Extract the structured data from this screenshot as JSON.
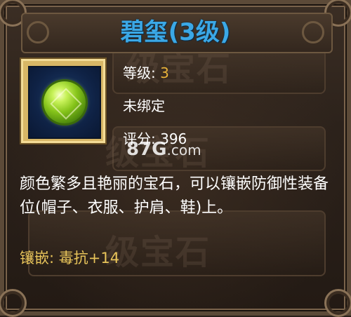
{
  "item": {
    "name": "碧玺(3级)",
    "name_color": "#3ba8e6",
    "level_label": "等级:",
    "level_value": "3",
    "bind_status": "未绑定",
    "score_label": "评分:",
    "score_value": "396",
    "description": "颜色繁多且艳丽的宝石，可以镶嵌防御性装备位(帽子、衣服、护肩、鞋)上。",
    "inlay_label": "镶嵌:",
    "inlay_effect": "毒抗+14",
    "icon": "green-gem-icon"
  },
  "background": {
    "ghost_text_1": "级宝石",
    "ghost_text_2": "级宝石",
    "ghost_text_3": "级宝石"
  },
  "watermark": {
    "text_main": "87G",
    "text_suffix": ".com"
  },
  "colors": {
    "value_gold": "#e8b23a",
    "inlay_gold": "#e8c45a",
    "gem_green": "#86c41b"
  }
}
